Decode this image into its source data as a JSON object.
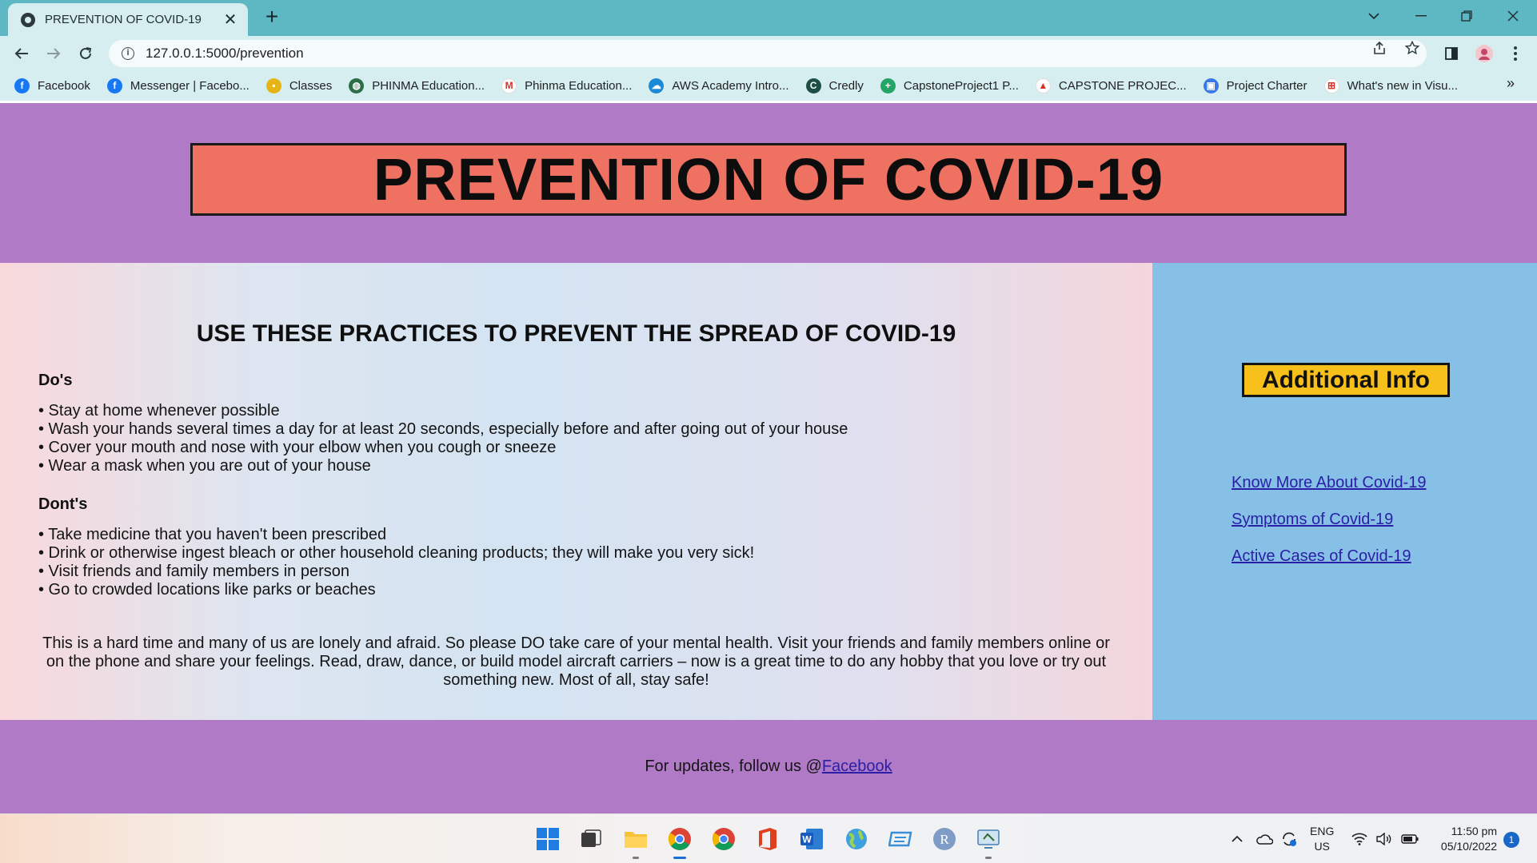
{
  "browser": {
    "tab_title": "PREVENTION OF COVID-19",
    "tab_close": "✕",
    "new_tab": "+",
    "url": "127.0.0.1:5000/prevention",
    "bookmarks": [
      {
        "label": "Facebook",
        "icon": "facebook-icon",
        "color": "#1877f2",
        "glyph": "f"
      },
      {
        "label": "Messenger | Facebo...",
        "icon": "facebook-icon",
        "color": "#1877f2",
        "glyph": "f"
      },
      {
        "label": "Classes",
        "icon": "classroom-icon",
        "color": "#e7b416",
        "glyph": "▪"
      },
      {
        "label": "PHINMA Education...",
        "icon": "globe-icon",
        "color": "#2c6e49",
        "glyph": "◍"
      },
      {
        "label": "Phinma Education...",
        "icon": "gmail-icon",
        "color": "#ffffff",
        "glyph": "M"
      },
      {
        "label": "AWS Academy Intro...",
        "icon": "cloud-icon",
        "color": "#1b8ad6",
        "glyph": "☁"
      },
      {
        "label": "Credly",
        "icon": "credly-icon",
        "color": "#1e4f45",
        "glyph": "C"
      },
      {
        "label": "CapstoneProject1 P...",
        "icon": "sheets-icon",
        "color": "#23a566",
        "glyph": "+"
      },
      {
        "label": "CAPSTONE PROJEC...",
        "icon": "drive-icon",
        "color": "#ffffff",
        "glyph": "▲"
      },
      {
        "label": "Project Charter",
        "icon": "contacts-icon",
        "color": "#3b78e7",
        "glyph": "▣"
      },
      {
        "label": "What's new in Visu...",
        "icon": "microsoft-icon",
        "color": "#ffffff",
        "glyph": "⊞"
      }
    ],
    "bookmarks_more": "»"
  },
  "page": {
    "title": "PREVENTION OF COVID-19",
    "heading": "USE THESE PRACTICES TO PREVENT THE SPREAD OF COVID-19",
    "dos_heading": "Do's",
    "dos": [
      "• Stay at home whenever possible",
      "• Wash your hands several times a day for at least 20 seconds, especially before and after going out of your house",
      "• Cover your mouth and nose with your elbow when you cough or sneeze",
      "• Wear a mask when you are out of your house"
    ],
    "donts_heading": "Dont's",
    "donts": [
      "• Take medicine that you haven't been prescribed",
      "• Drink or otherwise ingest bleach or other household cleaning products; they will make you very sick!",
      "• Visit friends and family members in person",
      "• Go to crowded locations like parks or beaches"
    ],
    "closing": "This is a hard time and many of us are lonely and afraid. So please DO take care of your mental health. Visit your friends and family members online or on the phone and share your feelings. Read, draw, dance, or build model aircraft carriers – now is a great time to do any hobby that you love or try out something new. Most of all, stay safe!",
    "sidebar": {
      "title": "Additional Info",
      "links": [
        "Know More About Covid-19",
        "Symptoms of Covid-19",
        "Active Cases of Covid-19"
      ]
    },
    "footer": {
      "text": "For updates, follow us @",
      "link": "Facebook"
    }
  },
  "taskbar": {
    "lang_top": "ENG",
    "lang_bottom": "US",
    "time": "11:50 pm",
    "date": "05/10/2022",
    "notifications": "1"
  },
  "colors": {
    "header_bg": "#b07ac6",
    "title_box": "#ee7162",
    "sidebar_bg": "#86c0e6",
    "info_box": "#f8c01a",
    "link": "#2a1fa6"
  }
}
